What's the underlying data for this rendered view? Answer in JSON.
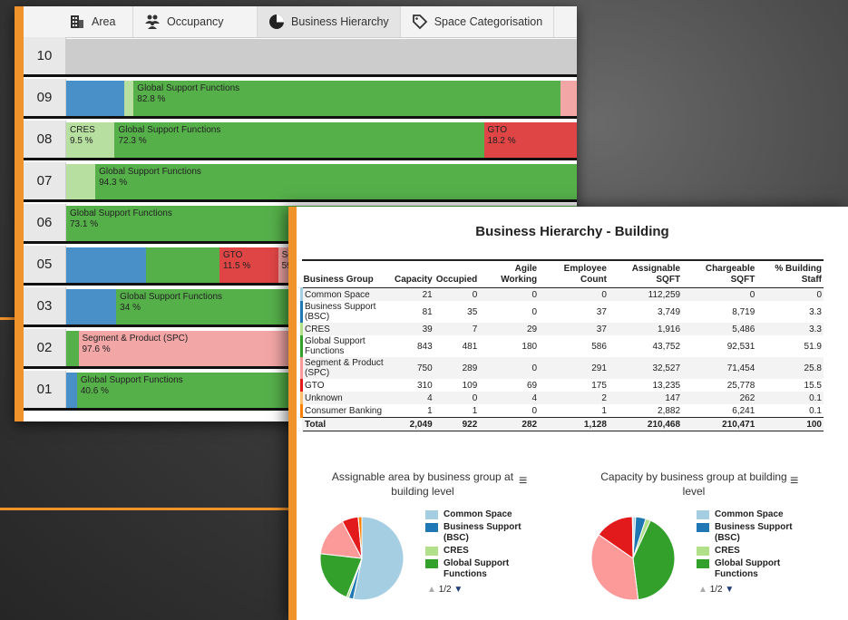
{
  "colors": {
    "accent": "#f0932b",
    "common_space": "#a6cee3",
    "business_support": "#1f78b4",
    "cres": "#b2df8a",
    "global_support": "#33a02c",
    "segment_product": "#fb9a99",
    "gto": "#e31a1c",
    "unknown": "#fdbf6f",
    "consumer_banking": "#ff7f00"
  },
  "tabs": [
    {
      "label": "Area",
      "icon": "building-icon"
    },
    {
      "label": "Occupancy",
      "icon": "people-icon"
    },
    {
      "label": "Business Hierarchy",
      "icon": "pie-icon"
    },
    {
      "label": "Space Categorisation",
      "icon": "tag-icon"
    }
  ],
  "floors": [
    {
      "label": "10",
      "segments": [
        {
          "w": 100,
          "color": "#cccccc",
          "name": "",
          "pct": ""
        }
      ]
    },
    {
      "label": "09",
      "segments": [
        {
          "w": 11.4,
          "color": "#4a90c8",
          "name": "",
          "pct": ""
        },
        {
          "w": 1.8,
          "color": "#b7e0a0",
          "name": "",
          "pct": ""
        },
        {
          "w": 83.6,
          "color": "#56b04a",
          "name": "Global Support Functions",
          "pct": "82.8 %"
        },
        {
          "w": 3.2,
          "color": "#f3a6a6",
          "name": "",
          "pct": ""
        }
      ]
    },
    {
      "label": "08",
      "segments": [
        {
          "w": 9.5,
          "color": "#b7e0a0",
          "name": "CRES",
          "pct": "9.5 %"
        },
        {
          "w": 72.3,
          "color": "#56b04a",
          "name": "Global Support Functions",
          "pct": "72.3 %"
        },
        {
          "w": 18.2,
          "color": "#e04545",
          "name": "GTO",
          "pct": "18.2 %"
        }
      ]
    },
    {
      "label": "07",
      "segments": [
        {
          "w": 5.7,
          "color": "#b7e0a0",
          "name": "",
          "pct": ""
        },
        {
          "w": 94.3,
          "color": "#56b04a",
          "name": "Global Support Functions",
          "pct": "94.3 %"
        }
      ]
    },
    {
      "label": "06",
      "segments": [
        {
          "w": 100,
          "color": "#56b04a",
          "name": "Global Support Functions",
          "pct": "73.1 %"
        }
      ]
    },
    {
      "label": "05",
      "segments": [
        {
          "w": 15.7,
          "color": "#4a90c8",
          "name": "",
          "pct": ""
        },
        {
          "w": 14.3,
          "color": "#56b04a",
          "name": "",
          "pct": ""
        },
        {
          "w": 11.5,
          "color": "#e04545",
          "name": "GTO",
          "pct": "11.5 %"
        },
        {
          "w": 58.5,
          "color": "#f3a6a6",
          "name": "Se",
          "pct": "59"
        }
      ]
    },
    {
      "label": "03",
      "segments": [
        {
          "w": 9.8,
          "color": "#4a90c8",
          "name": "",
          "pct": ""
        },
        {
          "w": 90.2,
          "color": "#56b04a",
          "name": "Global Support Functions",
          "pct": "34 %"
        }
      ]
    },
    {
      "label": "02",
      "segments": [
        {
          "w": 2.4,
          "color": "#56b04a",
          "name": "",
          "pct": ""
        },
        {
          "w": 97.6,
          "color": "#f3a6a6",
          "name": "Segment & Product (SPC)",
          "pct": "97.6 %"
        }
      ]
    },
    {
      "label": "01",
      "segments": [
        {
          "w": 2.1,
          "color": "#4a90c8",
          "name": "",
          "pct": ""
        },
        {
          "w": 97.9,
          "color": "#56b04a",
          "name": "Global Support Functions",
          "pct": "40.6 %"
        }
      ]
    }
  ],
  "report": {
    "title": "Business Hierarchy - Building",
    "columns": [
      "Business Group",
      "Capacity",
      "Occupied",
      "Agile Working",
      "Employee Count",
      "Assignable SQFT",
      "Chargeable SQFT",
      "% Building Staff"
    ],
    "rows": [
      {
        "color": "#a6cee3",
        "cells": [
          "Common Space",
          "21",
          "0",
          "0",
          "0",
          "112,259",
          "0",
          "0"
        ]
      },
      {
        "color": "#1f78b4",
        "cells": [
          "Business Support (BSC)",
          "81",
          "35",
          "0",
          "37",
          "3,749",
          "8,719",
          "3.3"
        ]
      },
      {
        "color": "#b2df8a",
        "cells": [
          "CRES",
          "39",
          "7",
          "29",
          "37",
          "1,916",
          "5,486",
          "3.3"
        ]
      },
      {
        "color": "#33a02c",
        "cells": [
          "Global Support Functions",
          "843",
          "481",
          "180",
          "586",
          "43,752",
          "92,531",
          "51.9"
        ]
      },
      {
        "color": "#fb9a99",
        "cells": [
          "Segment & Product (SPC)",
          "750",
          "289",
          "0",
          "291",
          "32,527",
          "71,454",
          "25.8"
        ]
      },
      {
        "color": "#e31a1c",
        "cells": [
          "GTO",
          "310",
          "109",
          "69",
          "175",
          "13,235",
          "25,778",
          "15.5"
        ]
      },
      {
        "color": "#fdbf6f",
        "cells": [
          "Unknown",
          "4",
          "0",
          "4",
          "2",
          "147",
          "262",
          "0.1"
        ]
      },
      {
        "color": "#ff7f00",
        "cells": [
          "Consumer Banking",
          "1",
          "1",
          "0",
          "1",
          "2,882",
          "6,241",
          "0.1"
        ]
      }
    ],
    "total": [
      "Total",
      "2,049",
      "922",
      "282",
      "1,128",
      "210,468",
      "210,471",
      "100"
    ]
  },
  "charts": [
    {
      "title": "Assignable area by business group at building level",
      "menu": "≡",
      "pager": "1/2",
      "values": [
        112259,
        3749,
        1916,
        43752,
        32527,
        13235,
        147,
        2882
      ]
    },
    {
      "title": "Capacity by business group at building level",
      "menu": "≡",
      "pager": "1/2",
      "values": [
        21,
        81,
        39,
        843,
        750,
        310,
        4,
        1
      ]
    }
  ],
  "legend": [
    {
      "label": "Common Space",
      "color": "#a6cee3"
    },
    {
      "label": "Business Support (BSC)",
      "color": "#1f78b4"
    },
    {
      "label": "CRES",
      "color": "#b2df8a"
    },
    {
      "label": "Global Support Functions",
      "color": "#33a02c"
    },
    {
      "label": "Segment & Product (SPC)",
      "color": "#fb9a99"
    }
  ]
}
